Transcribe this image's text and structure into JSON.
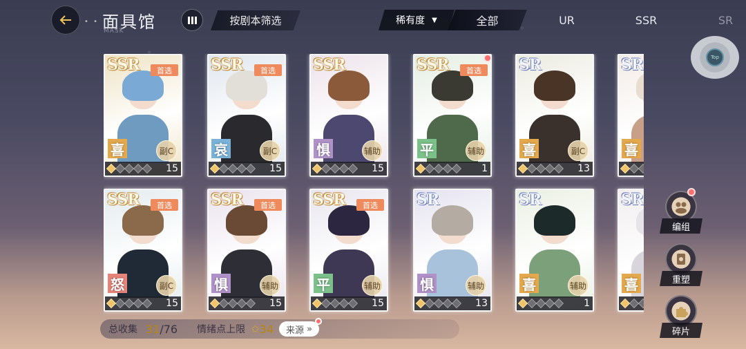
{
  "header": {
    "title": "面具馆",
    "subtitle": "MASK",
    "filter_label": "按剧本筛选",
    "rarity_dropdown": "稀有度",
    "tabs": [
      {
        "label": "全部",
        "active": true
      },
      {
        "label": "UR",
        "active": false
      },
      {
        "label": "SSR",
        "active": false
      },
      {
        "label": "SR",
        "active": false
      }
    ],
    "top_button": "Top"
  },
  "cards": [
    {
      "rarity": "SSR",
      "pick": "首选",
      "emotion": "喜",
      "role": "副C",
      "level": "15",
      "notice": false,
      "bg": "#efe3c4",
      "hair": "#7aa9d6",
      "body": "#6f9bc0",
      "emotion_color": "#e4a94d"
    },
    {
      "rarity": "SSR",
      "pick": "首选",
      "emotion": "哀",
      "role": "副C",
      "level": "15",
      "notice": false,
      "bg": "#dfe6ee",
      "hair": "#e2ded8",
      "body": "#2a2a2e",
      "emotion_color": "#7ab2d8"
    },
    {
      "rarity": "SSR",
      "pick": "",
      "emotion": "惧",
      "role": "辅助",
      "level": "15",
      "notice": false,
      "bg": "#ece2ea",
      "hair": "#8a5a3a",
      "body": "#4d4870",
      "emotion_color": "#b092c9"
    },
    {
      "rarity": "SSR",
      "pick": "首选",
      "emotion": "平",
      "role": "辅助",
      "level": "1",
      "notice": true,
      "bg": "#e4eee2",
      "hair": "#3b3a32",
      "body": "#4f6a4a",
      "emotion_color": "#7cc18a"
    },
    {
      "rarity": "SR",
      "pick": "",
      "emotion": "喜",
      "role": "副C",
      "level": "13",
      "notice": false,
      "bg": "#ecebe0",
      "hair": "#4a3426",
      "body": "#3a312c",
      "emotion_color": "#e4a94d"
    },
    {
      "rarity": "SR",
      "pick": "",
      "emotion": "喜",
      "role": "",
      "level": "",
      "notice": false,
      "bg": "#f3ece6",
      "hair": "#e8ddd0",
      "body": "#c8a08a",
      "emotion_color": "#e4a94d"
    },
    {
      "rarity": "SSR",
      "pick": "首选",
      "emotion": "怒",
      "role": "副C",
      "level": "15",
      "notice": false,
      "bg": "#e3ecef",
      "hair": "#8a6a4a",
      "body": "#1f2a36",
      "emotion_color": "#e6847a"
    },
    {
      "rarity": "SSR",
      "pick": "首选",
      "emotion": "惧",
      "role": "辅助",
      "level": "15",
      "notice": false,
      "bg": "#eae2ee",
      "hair": "#6a4a34",
      "body": "#2e2f36",
      "emotion_color": "#b092c9"
    },
    {
      "rarity": "SSR",
      "pick": "首选",
      "emotion": "平",
      "role": "辅助",
      "level": "15",
      "notice": false,
      "bg": "#e8e6ee",
      "hair": "#2c2640",
      "body": "#3e3854",
      "emotion_color": "#7cc18a"
    },
    {
      "rarity": "SR",
      "pick": "",
      "emotion": "惧",
      "role": "辅助",
      "level": "13",
      "notice": false,
      "bg": "#e4e2ef",
      "hair": "#b4aca2",
      "body": "#a8c2dc",
      "emotion_color": "#b092c9"
    },
    {
      "rarity": "SR",
      "pick": "",
      "emotion": "喜",
      "role": "辅助",
      "level": "1",
      "notice": false,
      "bg": "#eaf0e2",
      "hair": "#1d2a2a",
      "body": "#7ca07a",
      "emotion_color": "#e4a94d"
    },
    {
      "rarity": "SR",
      "pick": "",
      "emotion": "喜",
      "role": "",
      "level": "",
      "notice": false,
      "bg": "#f1eeee",
      "hair": "#e6e4e8",
      "body": "#d8d6dc",
      "emotion_color": "#e4a94d"
    }
  ],
  "footer": {
    "collection_label": "总收集",
    "collected": "31",
    "separator": "/",
    "total": "76",
    "emotion_cap_label": "情绪点上限",
    "emotion_cap_star": "✩",
    "emotion_cap_value": "34",
    "source_label": "来源",
    "source_arrow": "»"
  },
  "side_buttons": [
    {
      "label": "编组",
      "icon": "team-icon",
      "notice": true
    },
    {
      "label": "重塑",
      "icon": "reshape-icon",
      "notice": false
    },
    {
      "label": "碎片",
      "icon": "puzzle-icon",
      "notice": false
    }
  ]
}
